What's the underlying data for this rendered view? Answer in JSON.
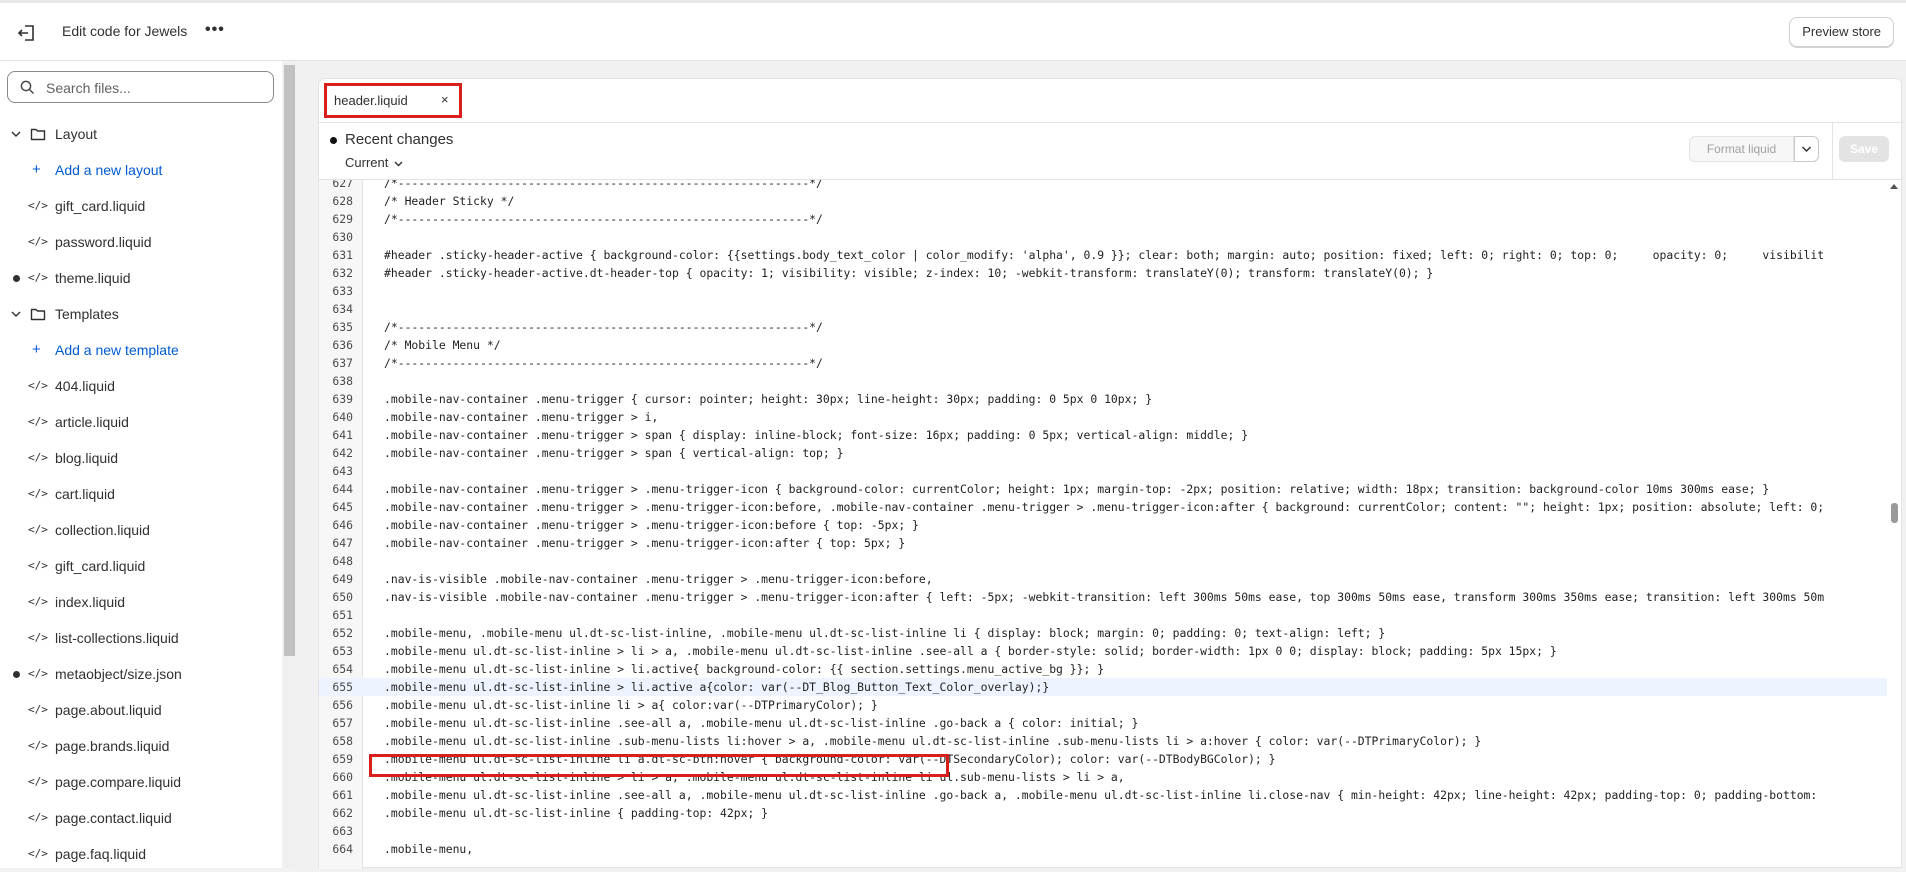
{
  "topbar": {
    "title": "Edit code for Jewels",
    "more": "•••",
    "preview_label": "Preview store"
  },
  "sidebar": {
    "search_placeholder": "Search files...",
    "items": [
      {
        "type": "folder",
        "label": "Layout"
      },
      {
        "type": "add",
        "label": "Add a new layout"
      },
      {
        "type": "file",
        "label": "gift_card.liquid",
        "dot": false
      },
      {
        "type": "file",
        "label": "password.liquid",
        "dot": false
      },
      {
        "type": "file",
        "label": "theme.liquid",
        "dot": true
      },
      {
        "type": "folder",
        "label": "Templates"
      },
      {
        "type": "add",
        "label": "Add a new template"
      },
      {
        "type": "file",
        "label": "404.liquid",
        "dot": false
      },
      {
        "type": "file",
        "label": "article.liquid",
        "dot": false
      },
      {
        "type": "file",
        "label": "blog.liquid",
        "dot": false
      },
      {
        "type": "file",
        "label": "cart.liquid",
        "dot": false
      },
      {
        "type": "file",
        "label": "collection.liquid",
        "dot": false
      },
      {
        "type": "file",
        "label": "gift_card.liquid",
        "dot": false
      },
      {
        "type": "file",
        "label": "index.liquid",
        "dot": false
      },
      {
        "type": "file",
        "label": "list-collections.liquid",
        "dot": false
      },
      {
        "type": "file",
        "label": "metaobject/size.json",
        "dot": true
      },
      {
        "type": "file",
        "label": "page.about.liquid",
        "dot": false
      },
      {
        "type": "file",
        "label": "page.brands.liquid",
        "dot": false
      },
      {
        "type": "file",
        "label": "page.compare.liquid",
        "dot": false
      },
      {
        "type": "file",
        "label": "page.contact.liquid",
        "dot": false
      },
      {
        "type": "file",
        "label": "page.faq.liquid",
        "dot": false
      }
    ]
  },
  "editor": {
    "tab_name": "header.liquid",
    "tab_close": "×",
    "recent_changes": "Recent changes",
    "current": "Current",
    "format_label": "Format liquid",
    "save_label": "Save",
    "highlight_line": 655,
    "lines": [
      {
        "n": "627",
        "t": "/*------------------------------------------------------------*/"
      },
      {
        "n": "628",
        "t": "/* Header Sticky */"
      },
      {
        "n": "629",
        "t": "/*------------------------------------------------------------*/"
      },
      {
        "n": "630",
        "t": ""
      },
      {
        "n": "631",
        "t": "#header .sticky-header-active { background-color: {{settings.body_text_color | color_modify: 'alpha', 0.9 }}; clear: both; margin: auto; position: fixed; left: 0; right: 0; top: 0;     opacity: 0;     visibilit"
      },
      {
        "n": "632",
        "t": "#header .sticky-header-active.dt-header-top { opacity: 1; visibility: visible; z-index: 10; -webkit-transform: translateY(0); transform: translateY(0); }"
      },
      {
        "n": "633",
        "t": ""
      },
      {
        "n": "634",
        "t": ""
      },
      {
        "n": "635",
        "t": "/*------------------------------------------------------------*/"
      },
      {
        "n": "636",
        "t": "/* Mobile Menu */"
      },
      {
        "n": "637",
        "t": "/*------------------------------------------------------------*/"
      },
      {
        "n": "638",
        "t": ""
      },
      {
        "n": "639",
        "t": ".mobile-nav-container .menu-trigger { cursor: pointer; height: 30px; line-height: 30px; padding: 0 5px 0 10px; }"
      },
      {
        "n": "640",
        "t": ".mobile-nav-container .menu-trigger > i,"
      },
      {
        "n": "641",
        "t": ".mobile-nav-container .menu-trigger > span { display: inline-block; font-size: 16px; padding: 0 5px; vertical-align: middle; }"
      },
      {
        "n": "642",
        "t": ".mobile-nav-container .menu-trigger > span { vertical-align: top; }"
      },
      {
        "n": "643",
        "t": ""
      },
      {
        "n": "644",
        "t": ".mobile-nav-container .menu-trigger > .menu-trigger-icon { background-color: currentColor; height: 1px; margin-top: -2px; position: relative; width: 18px; transition: background-color 10ms 300ms ease; }"
      },
      {
        "n": "645",
        "t": ".mobile-nav-container .menu-trigger > .menu-trigger-icon:before, .mobile-nav-container .menu-trigger > .menu-trigger-icon:after { background: currentColor; content: \"\"; height: 1px; position: absolute; left: 0;"
      },
      {
        "n": "646",
        "t": ".mobile-nav-container .menu-trigger > .menu-trigger-icon:before { top: -5px; }"
      },
      {
        "n": "647",
        "t": ".mobile-nav-container .menu-trigger > .menu-trigger-icon:after { top: 5px; }"
      },
      {
        "n": "648",
        "t": ""
      },
      {
        "n": "649",
        "t": ".nav-is-visible .mobile-nav-container .menu-trigger > .menu-trigger-icon:before,"
      },
      {
        "n": "650",
        "t": ".nav-is-visible .mobile-nav-container .menu-trigger > .menu-trigger-icon:after { left: -5px; -webkit-transition: left 300ms 50ms ease, top 300ms 50ms ease, transform 300ms 350ms ease; transition: left 300ms 50m"
      },
      {
        "n": "651",
        "t": ""
      },
      {
        "n": "652",
        "t": ".mobile-menu, .mobile-menu ul.dt-sc-list-inline, .mobile-menu ul.dt-sc-list-inline li { display: block; margin: 0; padding: 0; text-align: left; }"
      },
      {
        "n": "653",
        "t": ".mobile-menu ul.dt-sc-list-inline > li > a, .mobile-menu ul.dt-sc-list-inline .see-all a { border-style: solid; border-width: 1px 0 0; display: block; padding: 5px 15px; }"
      },
      {
        "n": "654",
        "t": ".mobile-menu ul.dt-sc-list-inline > li.active{ background-color: {{ section.settings.menu_active_bg }}; }"
      },
      {
        "n": "655",
        "t": ".mobile-menu ul.dt-sc-list-inline > li.active a{color: var(--DT_Blog_Button_Text_Color_overlay);}"
      },
      {
        "n": "656",
        "t": ".mobile-menu ul.dt-sc-list-inline li > a{ color:var(--DTPrimaryColor); }"
      },
      {
        "n": "657",
        "t": ".mobile-menu ul.dt-sc-list-inline .see-all a, .mobile-menu ul.dt-sc-list-inline .go-back a { color: initial; }"
      },
      {
        "n": "658",
        "t": ".mobile-menu ul.dt-sc-list-inline .sub-menu-lists li:hover > a, .mobile-menu ul.dt-sc-list-inline .sub-menu-lists li > a:hover { color: var(--DTPrimaryColor); }"
      },
      {
        "n": "659",
        "t": ".mobile-menu ul.dt-sc-list-inline li a.dt-sc-btn:hover { background-color: var(--DTSecondaryColor); color: var(--DTBodyBGColor); }"
      },
      {
        "n": "660",
        "t": ".mobile-menu ul.dt-sc-list-inline > li > a, .mobile-menu ul.dt-sc-list-inline li ul.sub-menu-lists > li > a,"
      },
      {
        "n": "661",
        "t": ".mobile-menu ul.dt-sc-list-inline .see-all a, .mobile-menu ul.dt-sc-list-inline .go-back a, .mobile-menu ul.dt-sc-list-inline li.close-nav { min-height: 42px; line-height: 42px; padding-top: 0; padding-bottom:"
      },
      {
        "n": "662",
        "t": ".mobile-menu ul.dt-sc-list-inline { padding-top: 42px; }"
      },
      {
        "n": "663",
        "t": ""
      },
      {
        "n": "664",
        "t": ".mobile-menu,"
      }
    ]
  }
}
